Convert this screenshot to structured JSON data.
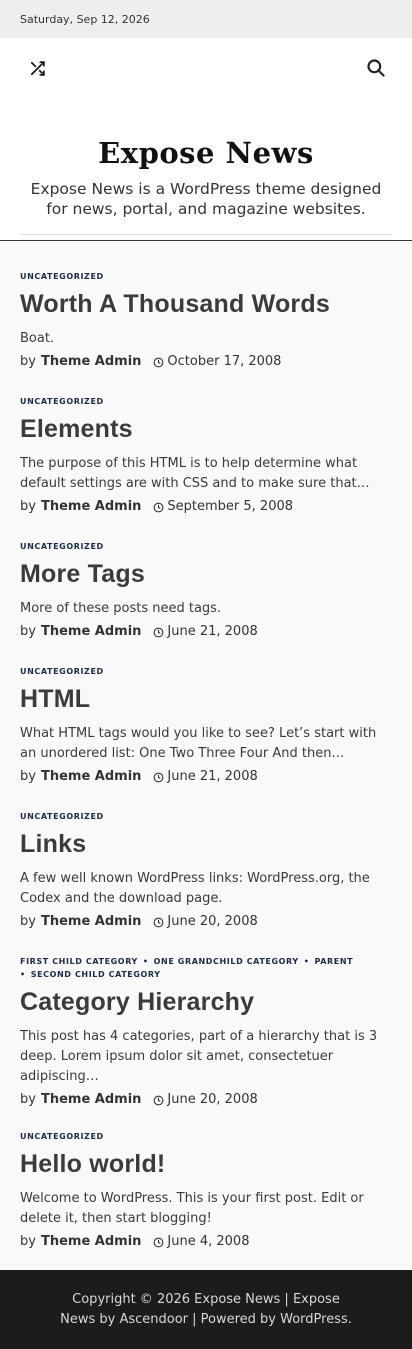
{
  "topbar": {
    "date": "Saturday, Sep 12, 2026"
  },
  "header": {
    "site_title": "Expose News",
    "tagline": "Expose News is a WordPress theme designed for news, portal, and magazine websites.",
    "shuffle_icon": "shuffle-icon",
    "search_icon": "search-icon"
  },
  "posts": [
    {
      "categories": [
        "UNCATEGORIZED"
      ],
      "title": "Worth A Thousand Words",
      "excerpt": "Boat.",
      "by": "by",
      "author": "Theme Admin",
      "date": "October 17, 2008"
    },
    {
      "categories": [
        "UNCATEGORIZED"
      ],
      "title": "Elements",
      "excerpt": "The purpose of this HTML is to help determine what default settings are with CSS and to make sure that…",
      "by": "by",
      "author": "Theme Admin",
      "date": "September 5, 2008"
    },
    {
      "categories": [
        "UNCATEGORIZED"
      ],
      "title": "More Tags",
      "excerpt": "More of these posts need tags.",
      "by": "by",
      "author": "Theme Admin",
      "date": "June 21, 2008"
    },
    {
      "categories": [
        "UNCATEGORIZED"
      ],
      "title": "HTML",
      "excerpt": "What HTML tags would you like to see? Let’s start with an unordered list: One Two Three Four And then…",
      "by": "by",
      "author": "Theme Admin",
      "date": "June 21, 2008"
    },
    {
      "categories": [
        "UNCATEGORIZED"
      ],
      "title": "Links",
      "excerpt": "A few well known WordPress links: WordPress.org, the Codex and the download page.",
      "by": "by",
      "author": "Theme Admin",
      "date": "June 20, 2008"
    },
    {
      "categories": [
        "FIRST CHILD CATEGORY",
        "ONE GRANDCHILD CATEGORY",
        "PARENT",
        "SECOND CHILD CATEGORY"
      ],
      "title": "Category Hierarchy",
      "excerpt": "This post has 4 categories, part of a hierarchy that is 3 deep. Lorem ipsum dolor sit amet, consectetuer adipiscing…",
      "by": "by",
      "author": "Theme Admin",
      "date": "June 20, 2008"
    },
    {
      "categories": [
        "UNCATEGORIZED"
      ],
      "title": "Hello world!",
      "excerpt": "Welcome to WordPress. This is your first post. Edit or delete it, then start blogging!",
      "by": "by",
      "author": "Theme Admin",
      "date": "June 4, 2008"
    }
  ],
  "footer": {
    "copyright": "Copyright © 2026 Expose News | Expose News by Ascendoor | Powered by WordPress."
  },
  "colors": {
    "category": "#1a2b48",
    "footer_bg": "#1c1c1c",
    "topbar_bg": "#eeeeee"
  }
}
